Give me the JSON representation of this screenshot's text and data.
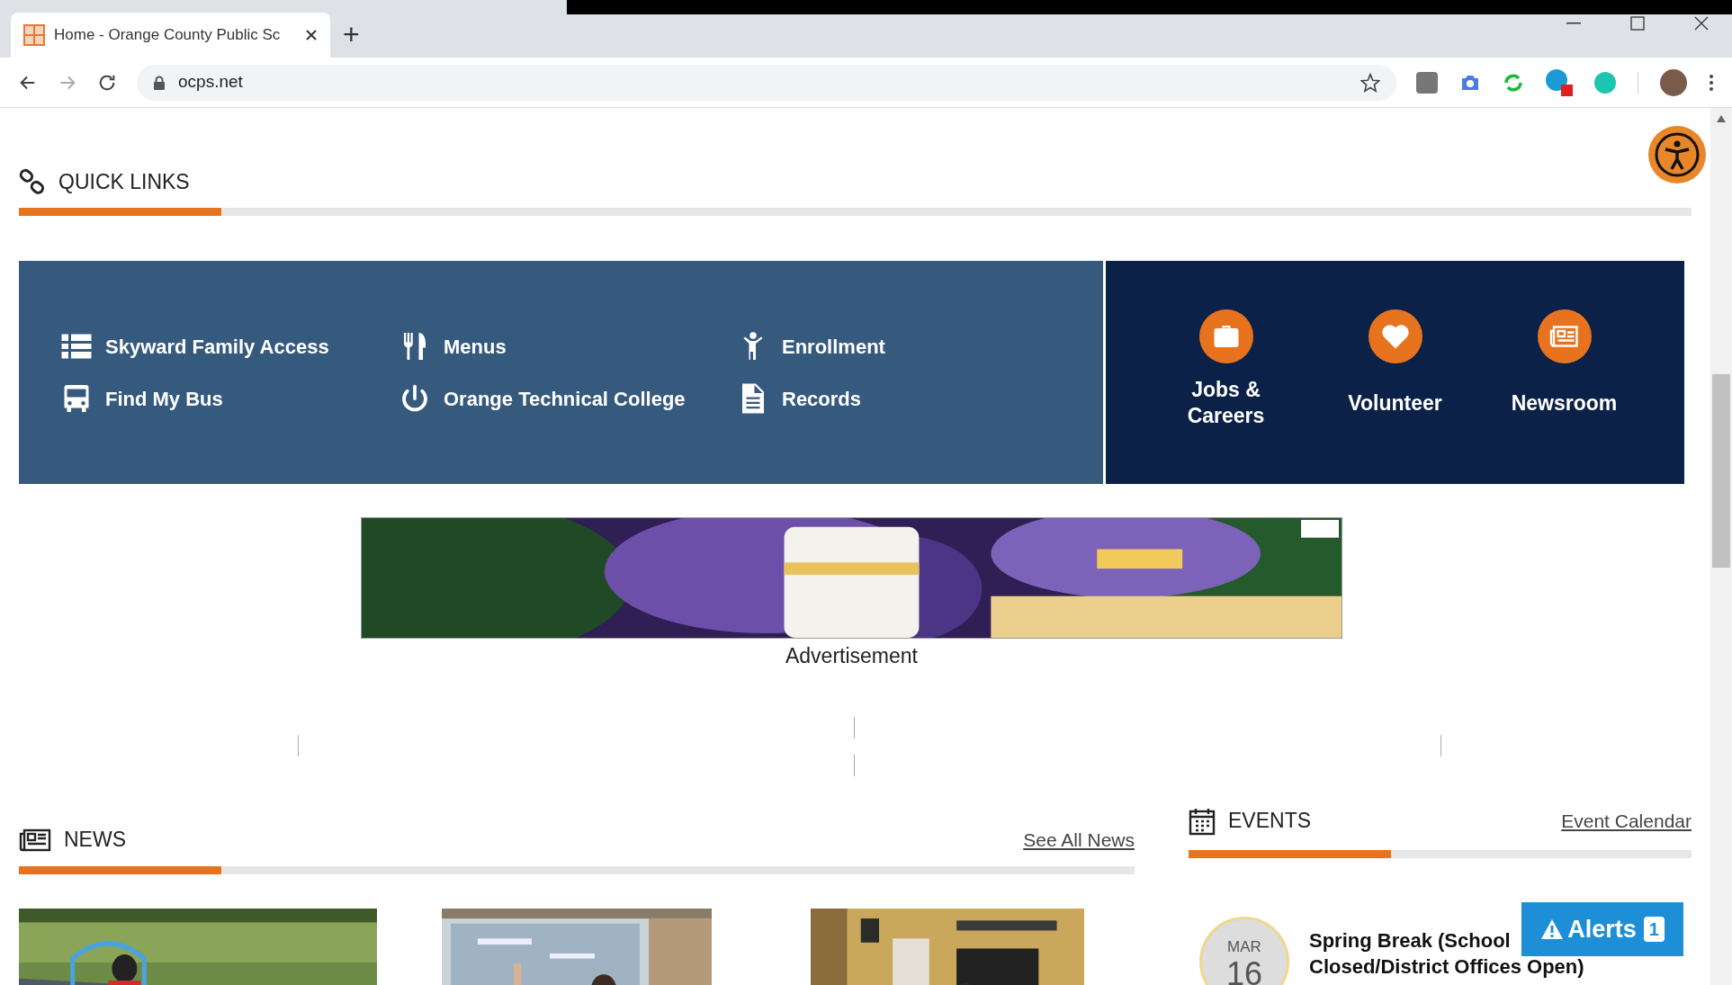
{
  "browser": {
    "tab_title": "Home - Orange County Public Sc",
    "url": "ocps.net",
    "new_tab": "+"
  },
  "quick_links": {
    "title": "QUICK LINKS",
    "links": [
      {
        "label": "Skyward Family Access"
      },
      {
        "label": "Menus"
      },
      {
        "label": "Enrollment"
      },
      {
        "label": "Find My Bus"
      },
      {
        "label": "Orange Technical College"
      },
      {
        "label": "Records"
      }
    ],
    "featured": [
      {
        "label": "Jobs & Careers"
      },
      {
        "label": "Volunteer"
      },
      {
        "label": "Newsroom"
      }
    ]
  },
  "ad": {
    "kind": "picture",
    "caption": "Advertisement"
  },
  "news": {
    "title": "NEWS",
    "link": "See All News"
  },
  "events": {
    "title": "EVENTS",
    "link": "Event Calendar",
    "items": [
      {
        "month": "MAR",
        "day": "16",
        "title": "Spring Break (School",
        "title_2": "Closed/District Offices Open)"
      }
    ]
  },
  "alerts": {
    "label": "Alerts",
    "count": "1"
  }
}
